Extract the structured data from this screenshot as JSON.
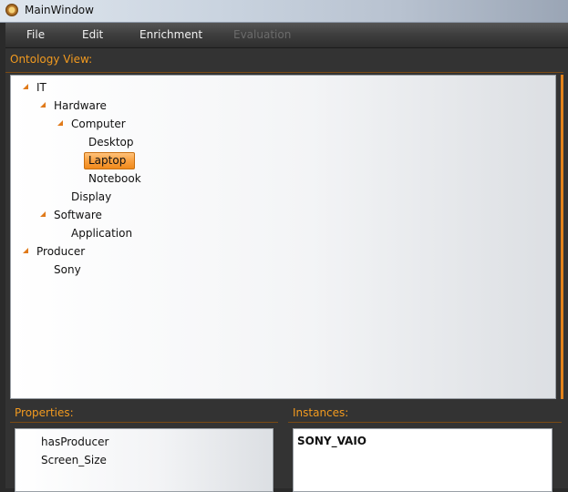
{
  "window": {
    "title": "MainWindow"
  },
  "menubar": {
    "items": [
      {
        "label": "File",
        "enabled": true
      },
      {
        "label": "Edit",
        "enabled": true
      },
      {
        "label": "Enrichment",
        "enabled": true
      },
      {
        "label": "Evaluation",
        "enabled": false
      }
    ]
  },
  "ontology": {
    "label": "Ontology View:",
    "tree": [
      {
        "label": "IT",
        "expanded": true
      },
      {
        "label": "Hardware",
        "expanded": true
      },
      {
        "label": "Computer",
        "expanded": true
      },
      {
        "label": "Desktop"
      },
      {
        "label": "Laptop",
        "selected": true
      },
      {
        "label": "Notebook"
      },
      {
        "label": "Display"
      },
      {
        "label": "Software",
        "expanded": true
      },
      {
        "label": "Application"
      },
      {
        "label": "Producer",
        "expanded": true
      },
      {
        "label": "Sony"
      }
    ]
  },
  "properties": {
    "label": "Properties:",
    "items": [
      "hasProducer",
      "Screen_Size"
    ]
  },
  "instances": {
    "label": "Instances:",
    "items": [
      "SONY_VAIO"
    ]
  },
  "colors": {
    "accent": "#f29a1f",
    "selection": "#f9a040"
  }
}
